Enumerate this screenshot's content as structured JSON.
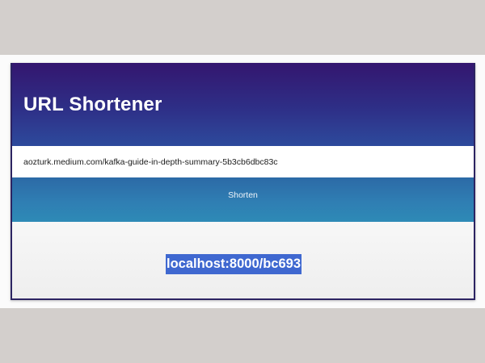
{
  "app": {
    "title": "URL Shortener"
  },
  "form": {
    "url_value": "aozturk.medium.com/kafka-guide-in-depth-summary-5b3cb6dbc83c",
    "shorten_label": "Shorten"
  },
  "result": {
    "short_url": "localhost:8000/bc693"
  },
  "colors": {
    "header_top": "#34166f",
    "header_bottom": "#2d4a9c",
    "button": "#2f7eb3",
    "selection_highlight": "#3f68d0"
  }
}
